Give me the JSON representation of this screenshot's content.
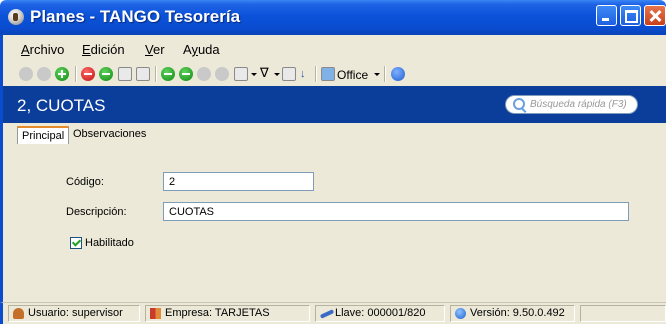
{
  "window": {
    "title": "Planes - TANGO Tesorería"
  },
  "menu": {
    "items": [
      {
        "label": "Archivo",
        "accel": "A",
        "rest": "rchivo"
      },
      {
        "label": "Edición",
        "accel": "E",
        "rest": "dición"
      },
      {
        "label": "Ver",
        "accel": "V",
        "rest": "er"
      },
      {
        "label": "Ayuda",
        "accel": "y",
        "pre": "A",
        "rest": "uda"
      }
    ]
  },
  "toolbar": {
    "office_label": "Office"
  },
  "record": {
    "title": "2, CUOTAS"
  },
  "search": {
    "placeholder": "Búsqueda rápida (F3)"
  },
  "tabs": [
    {
      "label": "Principal",
      "active": true
    },
    {
      "label": "Observaciones",
      "active": false
    }
  ],
  "form": {
    "codigo_label": "Código:",
    "codigo_value": "2",
    "descripcion_label": "Descripción:",
    "descripcion_value": "CUOTAS",
    "habilitado_label": "Habilitado",
    "habilitado_checked": true
  },
  "statusbar": {
    "usuario": "Usuario: supervisor",
    "empresa": "Empresa: TARJETAS",
    "llave": "Llave: 000001/820",
    "version": "Versión: 9.50.0.492"
  }
}
